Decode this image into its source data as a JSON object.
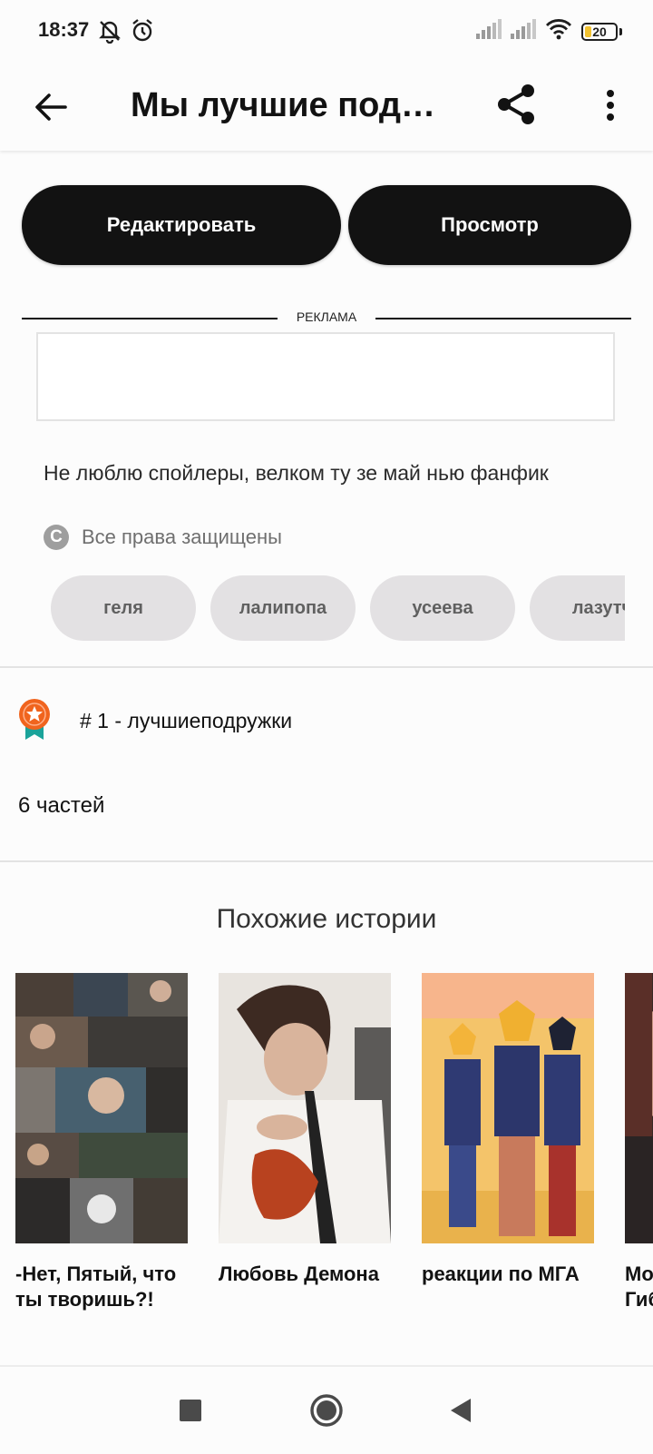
{
  "status_bar": {
    "time": "18:37",
    "battery_level": "20"
  },
  "toolbar": {
    "title": "Мы лучшие подр..."
  },
  "actions": {
    "edit_label": "Редактировать",
    "preview_label": "Просмотр"
  },
  "ad": {
    "label": "РЕКЛАМА"
  },
  "story": {
    "description": "Не люблю спойлеры, велком ту зе май нью фанфик",
    "copyright": "Все права защищены",
    "copyright_icon_letter": "C",
    "tags": [
      "геля",
      "лалипопа",
      "усеева",
      "лазутч"
    ],
    "ranking": "# 1 - лучшиеподружки",
    "parts": "6 частей"
  },
  "similar": {
    "title": "Похожие истории",
    "stories": [
      {
        "title": "-Нет, Пятый, что ты творишь?!"
      },
      {
        "title": "Любовь Демона"
      },
      {
        "title": "реакции по МГА"
      },
      {
        "title": "Мо Гиб"
      }
    ]
  },
  "colors": {
    "accent_dark": "#121212",
    "tag_background": "#e3e1e3",
    "ranking_badge": "#f0641e",
    "ranking_ribbon": "#1aa39a",
    "battery_fill": "#f2c230"
  },
  "icons": {
    "status": [
      "bell-off-icon",
      "alarm-icon",
      "signal-icon",
      "wifi-icon",
      "battery-icon"
    ],
    "toolbar": [
      "back-arrow-icon",
      "share-icon",
      "more-vertical-icon"
    ],
    "nav": [
      "recent-apps-icon",
      "home-icon",
      "back-nav-icon"
    ]
  }
}
